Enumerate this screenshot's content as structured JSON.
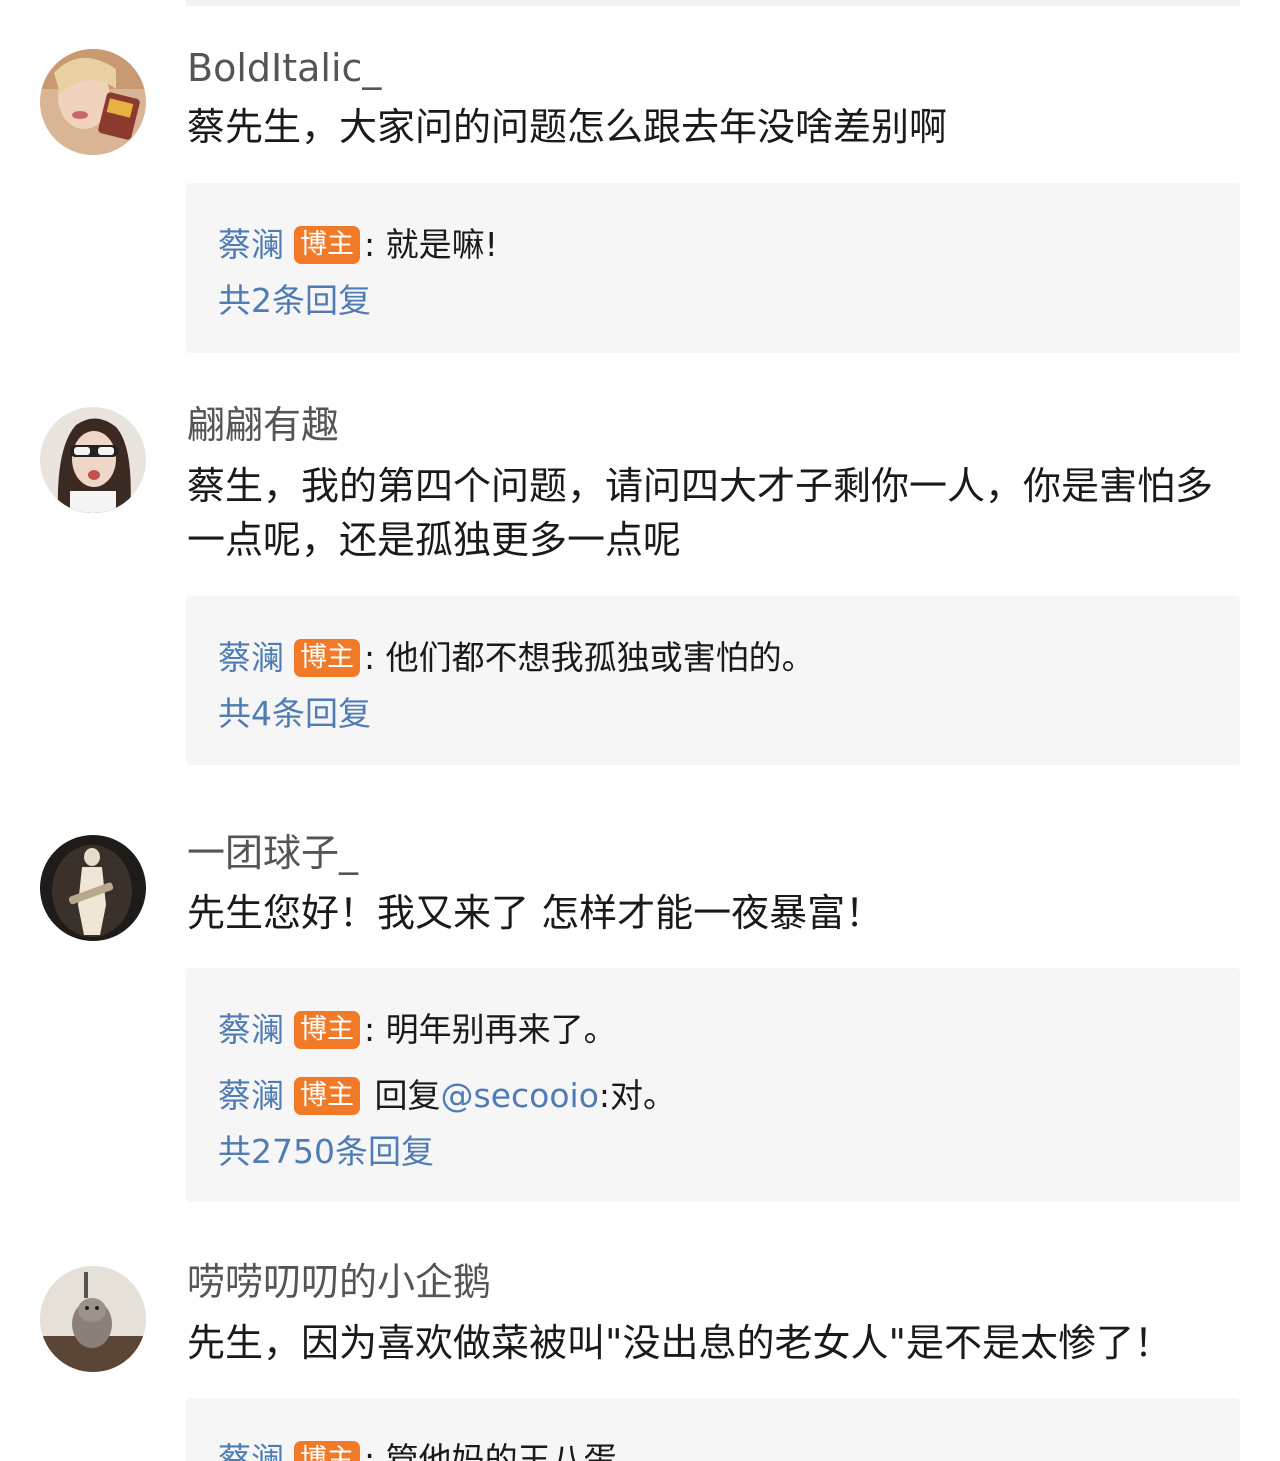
{
  "colors": {
    "link_blue": "#4f7cb5",
    "badge_orange": "#f07a28",
    "reply_bg": "#f6f6f6",
    "username_gray": "#555555"
  },
  "comments": [
    {
      "username": "BoldItalic_",
      "text": "蔡先生，大家问的问题怎么跟去年没啥差别啊",
      "replies": [
        {
          "author": "蔡澜",
          "badge": "博主",
          "prefix": ": ",
          "mention": "",
          "text": "就是嘛!"
        }
      ],
      "reply_count": "共2条回复"
    },
    {
      "username": "翩翩有趣",
      "text": "蔡生，我的第四个问题，请问四大才子剩你一人，你是害怕多一点呢，还是孤独更多一点呢",
      "replies": [
        {
          "author": "蔡澜",
          "badge": "博主",
          "prefix": ": ",
          "mention": "",
          "text": "他们都不想我孤独或害怕的。"
        }
      ],
      "reply_count": "共4条回复"
    },
    {
      "username": "一团球子_",
      "text": "先生您好！我又来了 怎样才能一夜暴富！",
      "replies": [
        {
          "author": "蔡澜",
          "badge": "博主",
          "prefix": ": ",
          "mention": "",
          "text": "明年别再来了。"
        },
        {
          "author": "蔡澜",
          "badge": "博主",
          "prefix": " 回复",
          "mention": "@secooio",
          "text": ":对。"
        }
      ],
      "reply_count": "共2750条回复"
    },
    {
      "username": "唠唠叨叨的小企鹅",
      "text": "先生，因为喜欢做菜被叫\"没出息的老女人\"是不是太惨了！",
      "replies": [
        {
          "author": "蔡澜",
          "badge": "博主",
          "prefix": ": ",
          "mention": "",
          "text": "管他妈的王八蛋"
        }
      ],
      "reply_count": ""
    }
  ]
}
